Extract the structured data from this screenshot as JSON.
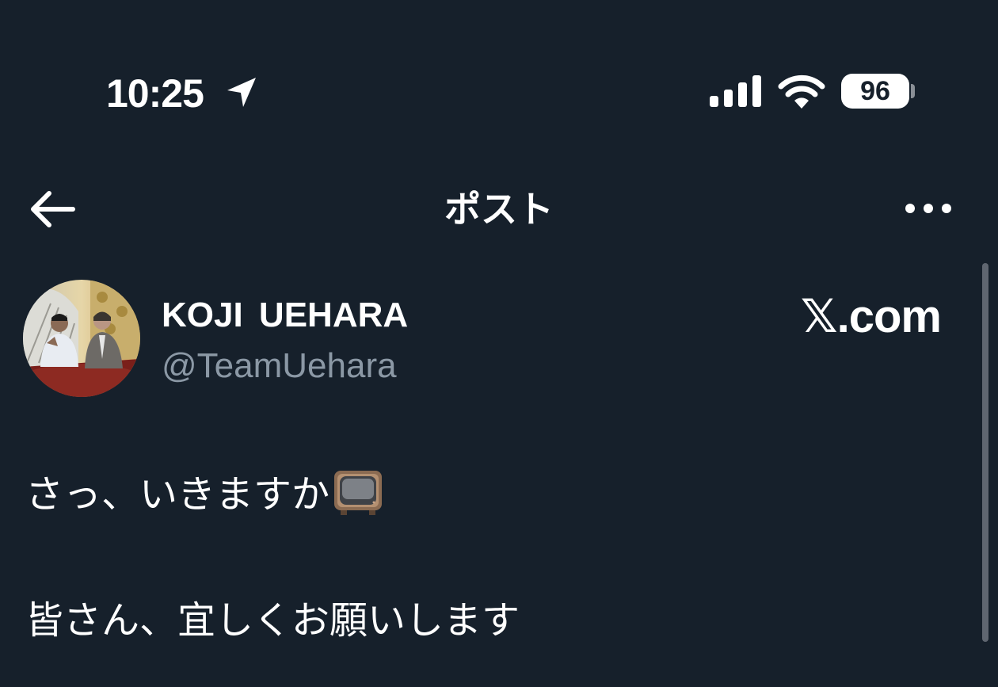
{
  "status_bar": {
    "time": "10:25",
    "battery_level": "96",
    "icons": [
      "location-arrow-icon",
      "cellular-signal-icon",
      "wifi-icon",
      "battery-icon"
    ]
  },
  "nav": {
    "title": "ポスト",
    "back_icon": "back-arrow-icon",
    "more_icon": "more-options-icon"
  },
  "post": {
    "author_name": "KOJI  UEHARA",
    "author_handle": "@TeamUehara",
    "source": "𝕏.com",
    "text_line1": "さっ、いきますか",
    "text_emoji": "television-icon",
    "text_line2": "皆さん、宜しくお願いします"
  },
  "colors": {
    "background": "#16202b",
    "text_primary": "#ffffff",
    "text_secondary": "#8b98a5"
  }
}
